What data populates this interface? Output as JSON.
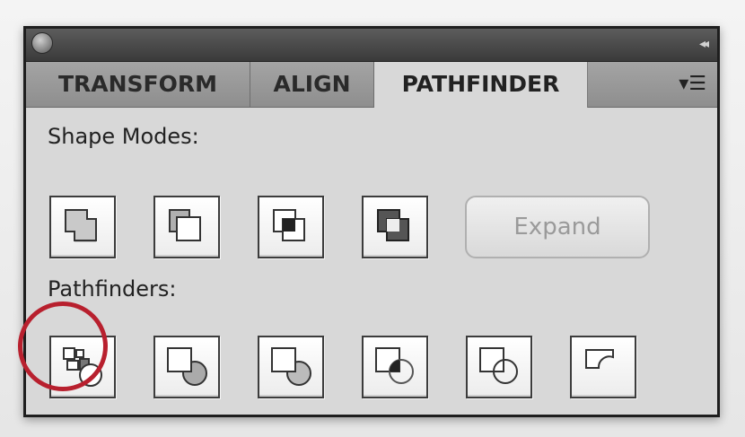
{
  "tabs": [
    {
      "label": "TRANSFORM"
    },
    {
      "label": "ALIGN"
    },
    {
      "label": "PATHFINDER"
    }
  ],
  "active_tab": "PATHFINDER",
  "icons": {
    "collapse": "double-chevron-left-icon",
    "menu": "panel-menu-icon"
  },
  "shape_modes": {
    "label": "Shape Modes:",
    "buttons": [
      "unite",
      "minus-front",
      "intersect",
      "exclude"
    ],
    "expand_label": "Expand"
  },
  "pathfinders": {
    "label": "Pathfinders:",
    "buttons": [
      "divide",
      "trim",
      "merge",
      "crop",
      "outline",
      "minus-back"
    ]
  },
  "colors": {
    "highlight": "#b8202e",
    "panel_bg": "#d8d8d8",
    "titlebar": "#3a3a3a"
  }
}
